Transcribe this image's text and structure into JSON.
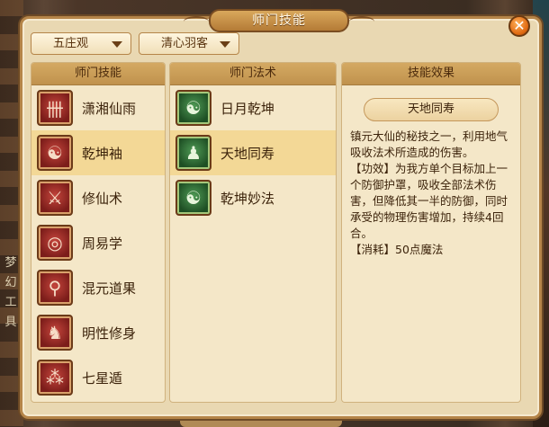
{
  "window": {
    "title": "师门技能"
  },
  "background": {
    "side_text": "梦幻工具"
  },
  "filters": {
    "sect": "五庄观",
    "character": "清心羽客"
  },
  "columns": {
    "skills_header": "师门技能",
    "spells_header": "师门法术",
    "effect_header": "技能效果"
  },
  "skills": [
    {
      "label": "潇湘仙雨",
      "icon": "scroll-icon",
      "glyph": "卌",
      "selected": false
    },
    {
      "label": "乾坤袖",
      "icon": "yin-yang-icon",
      "glyph": "☯",
      "selected": true
    },
    {
      "label": "修仙术",
      "icon": "sword-icon",
      "glyph": "⚔",
      "selected": false
    },
    {
      "label": "周易学",
      "icon": "coin-icon",
      "glyph": "◎",
      "selected": false
    },
    {
      "label": "混元道果",
      "icon": "orb-icon",
      "glyph": "⚲",
      "selected": false
    },
    {
      "label": "明性修身",
      "icon": "lion-icon",
      "glyph": "♞",
      "selected": false
    },
    {
      "label": "七星遁",
      "icon": "stars-icon",
      "glyph": "⁂",
      "selected": false
    }
  ],
  "spells": [
    {
      "label": "日月乾坤",
      "icon": "yin-yang-icon",
      "glyph": "☯",
      "selected": false
    },
    {
      "label": "天地同寿",
      "icon": "deity-icon",
      "glyph": "♟",
      "selected": true
    },
    {
      "label": "乾坤妙法",
      "icon": "yin-yang-icon",
      "glyph": "☯",
      "selected": false
    }
  ],
  "effect": {
    "title": "天地同寿",
    "description": "镇元大仙的秘技之一，利用地气吸收法术所造成的伤害。\n【功效】为我方单个目标加上一个防御护罩，吸收全部法术伤害，但降低其一半的防御，同时承受的物理伤害增加，持续4回合。\n【消耗】50点魔法"
  },
  "colors": {
    "accent": "#b58549",
    "selected_row": "#f3d896",
    "close_button": "#e06a12"
  }
}
